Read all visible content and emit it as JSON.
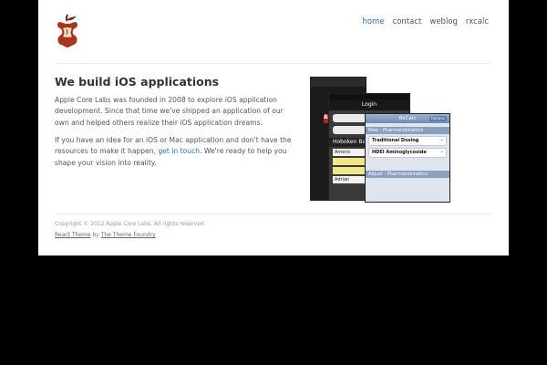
{
  "nav": {
    "items": [
      {
        "label": "home",
        "active": true
      },
      {
        "label": "contact",
        "active": false
      },
      {
        "label": "weblog",
        "active": false
      },
      {
        "label": "rxcalc",
        "active": false
      }
    ]
  },
  "main": {
    "headline": "We build iOS applications",
    "paragraph1": "Apple Core Labs was founded in 2008 to explore iOS application development. Since that time we've shipped an application of our own and helped others realize their iOS application dreams.",
    "paragraph2_before": "If you have an idea for an iOS or Mac application and don't have the resources to make it happen, ",
    "paragraph2_link": "get in touch",
    "paragraph2_after": ". We're ready to help you shape your vision into reality."
  },
  "screens": {
    "phone1_badge": "AU",
    "phone2_title": "Login",
    "phone2_name": "Hoboken Barneys",
    "phone2_row1": "Americ",
    "phone2_row2": "Adrian",
    "phone3_title": "RxCalc",
    "phone3_options": "Options",
    "phone3_section1": "New - Pharmacokinetics",
    "phone3_cell1": "Traditional Dosing",
    "phone3_cell2": "HDEI Aminoglycoside",
    "phone3_section2": "Adjust - Pharmacokinetics"
  },
  "footer": {
    "copyright": "Copyright © 2012 Apple Core Labs. All rights reserved.",
    "theme_link": "React Theme",
    "by": " by ",
    "foundry_link": "The Theme Foundry"
  },
  "colors": {
    "link": "#2a6fb5",
    "background": "#000000",
    "page": "#ffffff"
  }
}
